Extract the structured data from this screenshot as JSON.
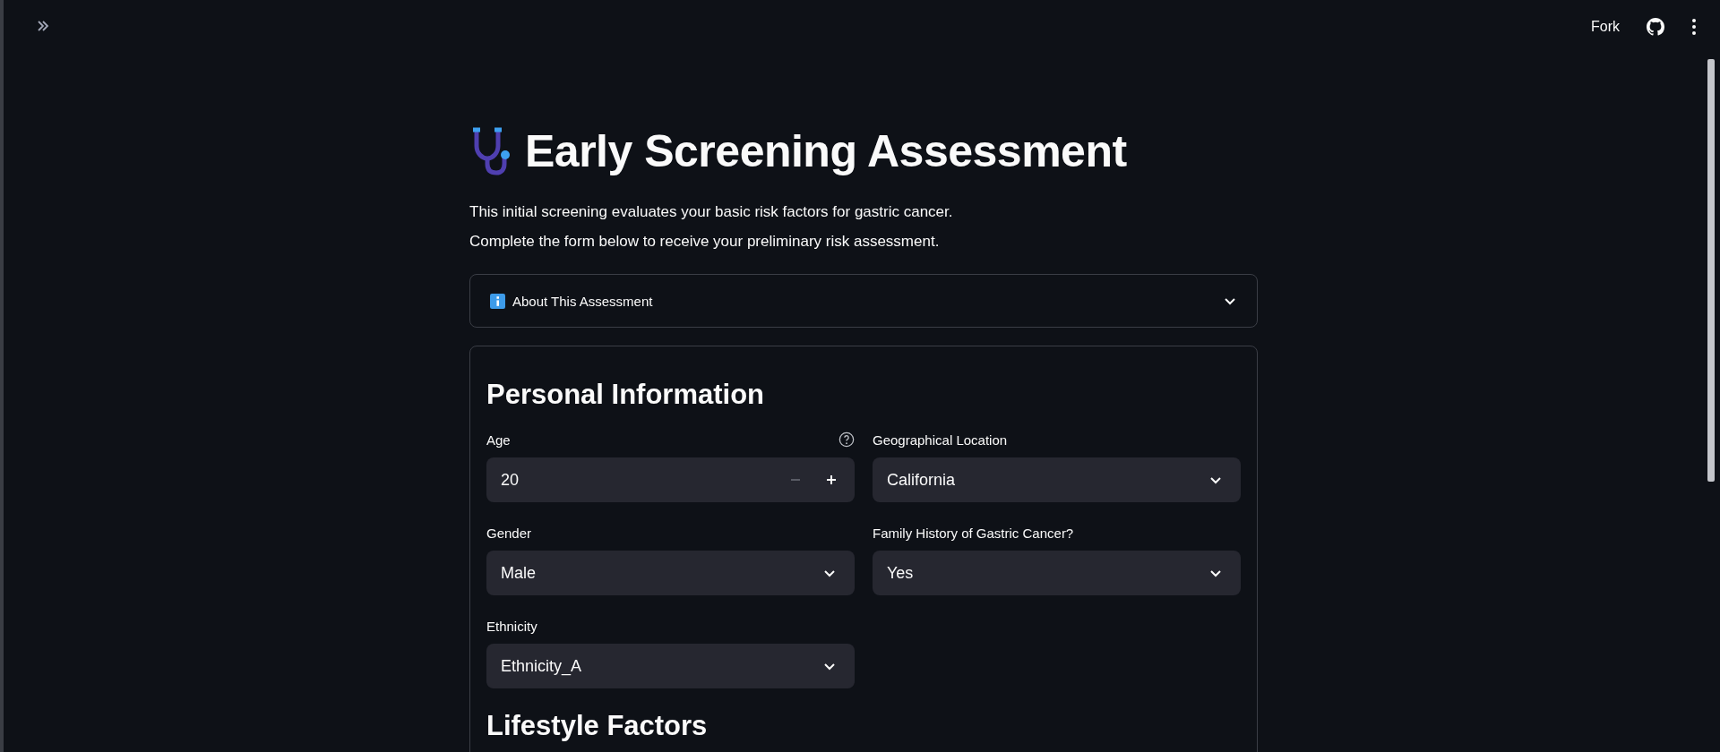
{
  "header": {
    "actions": [
      {
        "kind": "text",
        "label": "Fork"
      },
      {
        "kind": "github"
      },
      {
        "kind": "menu"
      }
    ]
  },
  "title": "Early Screening Assessment",
  "intro": [
    "This initial screening evaluates your basic risk factors for gastric cancer.",
    "Complete the form below to receive your preliminary risk assessment."
  ],
  "expander": {
    "label": "About This Assessment",
    "expanded": false
  },
  "form": {
    "sections": [
      {
        "heading": "Personal Information",
        "fields": [
          {
            "kind": "number",
            "label": "Age",
            "help": true,
            "value": "20"
          },
          {
            "kind": "select",
            "label": "Geographical Location",
            "value": "California"
          },
          {
            "kind": "select",
            "label": "Gender",
            "value": "Male"
          },
          {
            "kind": "select",
            "label": "Family History of Gastric Cancer?",
            "value": "Yes"
          },
          {
            "kind": "select",
            "label": "Ethnicity",
            "value": "Ethnicity_A"
          }
        ]
      },
      {
        "heading": "Lifestyle Factors"
      }
    ]
  }
}
